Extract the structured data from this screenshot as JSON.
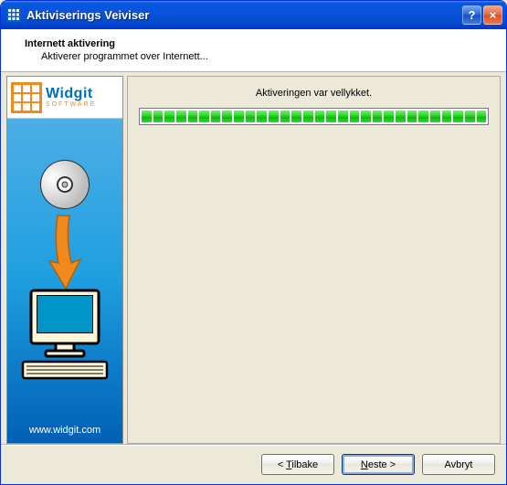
{
  "window": {
    "title": "Aktiviserings Veiviser",
    "help_symbol": "?",
    "close_symbol": "×"
  },
  "header": {
    "heading": "Internett aktivering",
    "subtext": "Aktiverer programmet over Internett..."
  },
  "sidebar": {
    "logo_name": "Widgit",
    "logo_tagline": "SOFTWARE",
    "url": "www.widgit.com"
  },
  "main": {
    "status_text": "Aktiveringen var vellykket.",
    "progress_segments": 30
  },
  "footer": {
    "back_prefix": "< ",
    "back_u": "T",
    "back_rest": "ilbake",
    "next_u": "N",
    "next_rest": "este",
    "next_suffix": " >",
    "cancel": "Avbryt"
  }
}
